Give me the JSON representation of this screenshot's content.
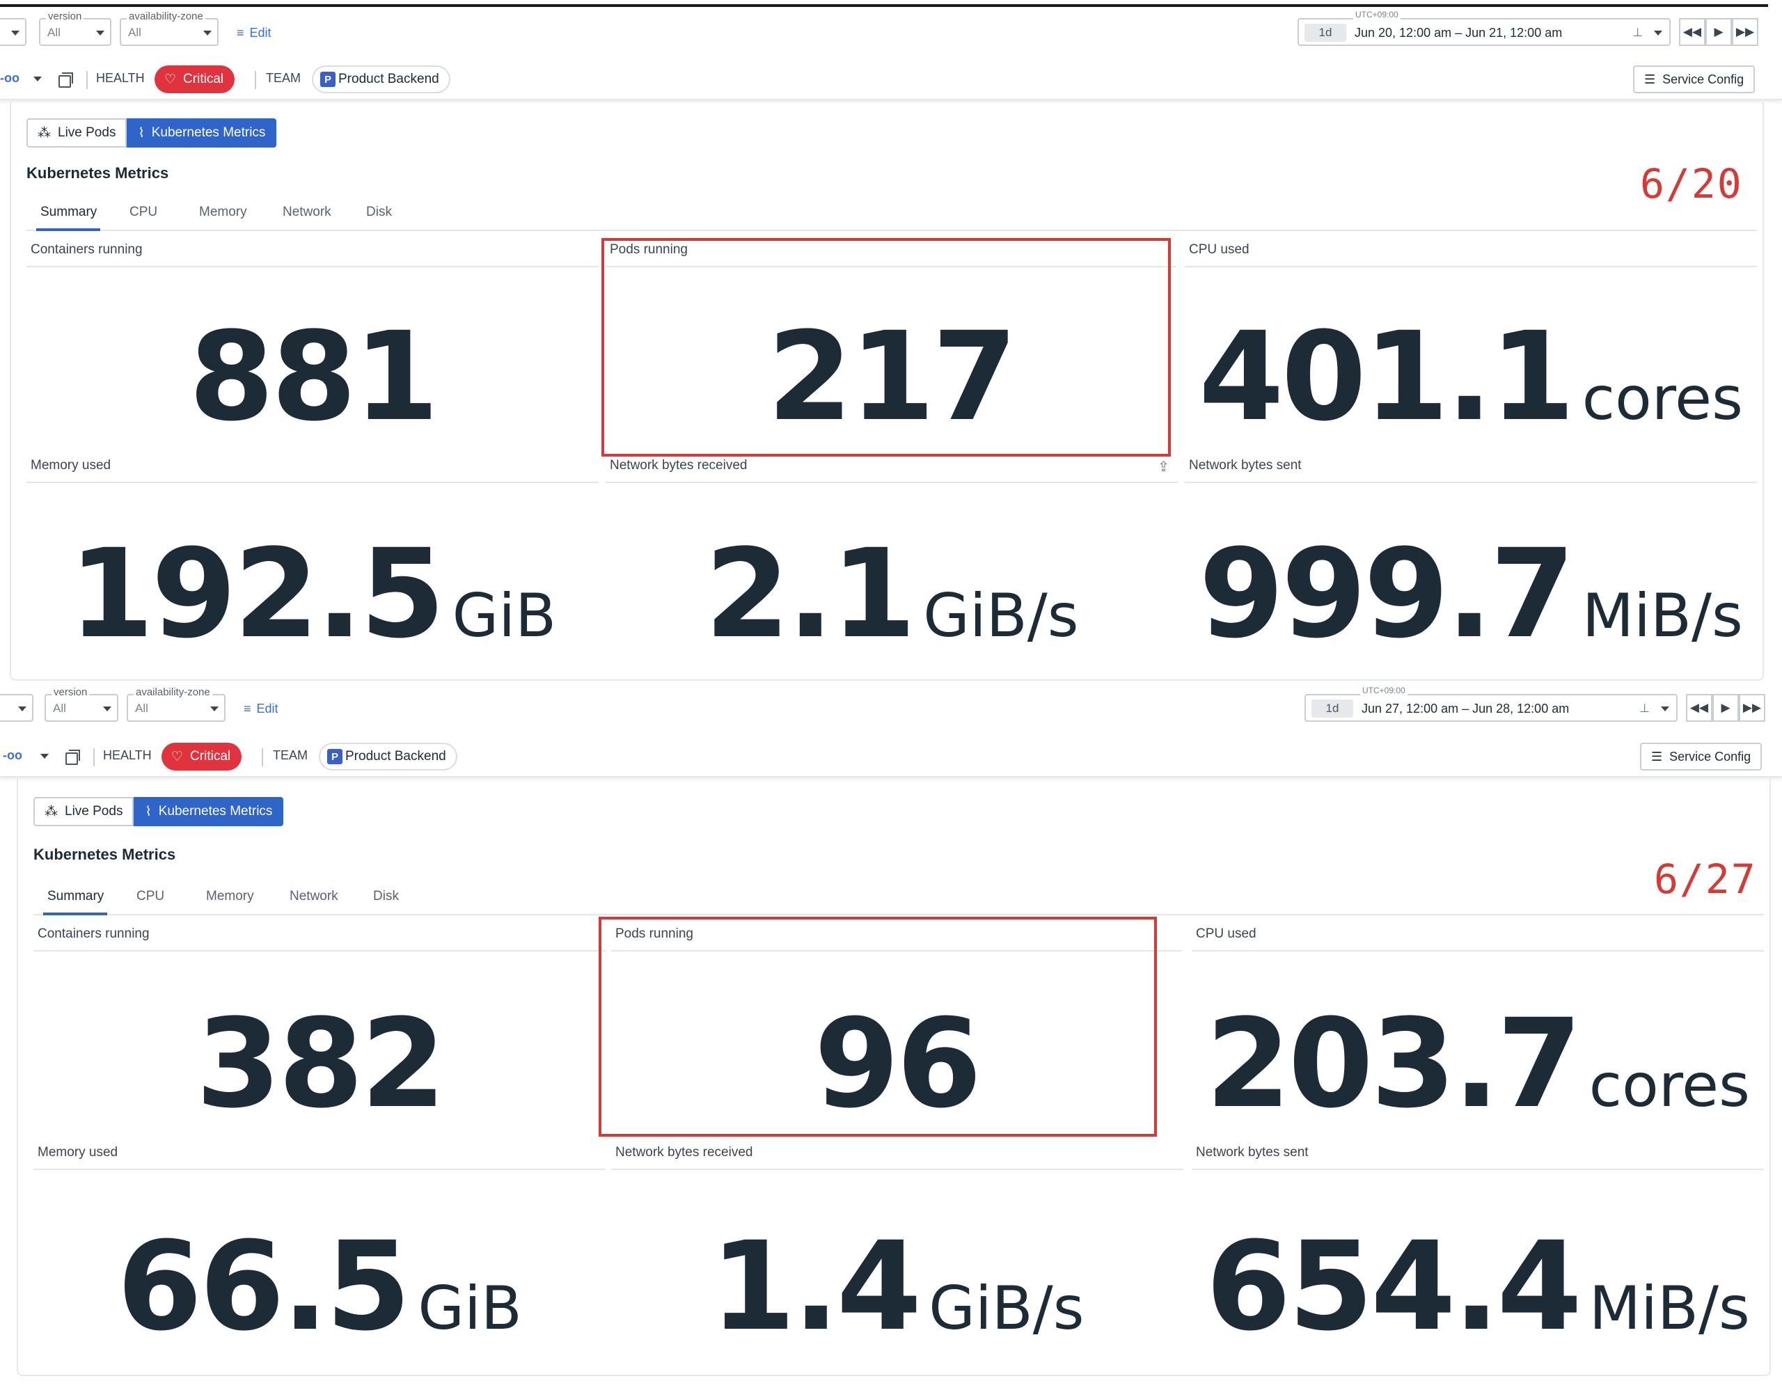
{
  "panels": [
    {
      "filters": {
        "version": {
          "label": "version",
          "value": "All"
        },
        "availability_zone": {
          "label": "availability-zone",
          "value": "All"
        },
        "edit_label": "Edit"
      },
      "time": {
        "timezone": "UTC+09:00",
        "range_tag": "1d",
        "range_text": "Jun 20, 12:00 am – Jun 21, 12:00 am"
      },
      "health": {
        "health_label": "HEALTH",
        "status_label": "Critical",
        "team_label": "TEAM",
        "team_badge": "P",
        "team_name": "Product Backend",
        "service_config_label": "Service Config"
      },
      "view_toggle": {
        "live_pods_label": "Live Pods",
        "k8s_metrics_label": "Kubernetes Metrics"
      },
      "section_title": "Kubernetes Metrics",
      "date_annotation": "6/20",
      "tabs": [
        "Summary",
        "CPU",
        "Memory",
        "Network",
        "Disk"
      ],
      "active_tab": "Summary",
      "metrics": {
        "containers_running": {
          "title": "Containers running",
          "value": "881",
          "unit": ""
        },
        "pods_running": {
          "title": "Pods running",
          "value": "217",
          "unit": ""
        },
        "cpu_used": {
          "title": "CPU used",
          "value": "401.1",
          "unit": "cores"
        },
        "memory_used": {
          "title": "Memory used",
          "value": "192.5",
          "unit": "GiB"
        },
        "net_received": {
          "title": "Network bytes received",
          "value": "2.1",
          "unit": "GiB/s"
        },
        "net_sent": {
          "title": "Network bytes sent",
          "value": "999.7",
          "unit": "MiB/s"
        }
      }
    },
    {
      "filters": {
        "version": {
          "label": "version",
          "value": "All"
        },
        "availability_zone": {
          "label": "availability-zone",
          "value": "All"
        },
        "edit_label": "Edit"
      },
      "time": {
        "timezone": "UTC+09:00",
        "range_tag": "1d",
        "range_text": "Jun 27, 12:00 am – Jun 28, 12:00 am"
      },
      "health": {
        "health_label": "HEALTH",
        "status_label": "Critical",
        "team_label": "TEAM",
        "team_badge": "P",
        "team_name": "Product Backend",
        "service_config_label": "Service Config"
      },
      "view_toggle": {
        "live_pods_label": "Live Pods",
        "k8s_metrics_label": "Kubernetes Metrics"
      },
      "section_title": "Kubernetes Metrics",
      "date_annotation": "6/27",
      "tabs": [
        "Summary",
        "CPU",
        "Memory",
        "Network",
        "Disk"
      ],
      "active_tab": "Summary",
      "metrics": {
        "containers_running": {
          "title": "Containers running",
          "value": "382",
          "unit": ""
        },
        "pods_running": {
          "title": "Pods running",
          "value": "96",
          "unit": ""
        },
        "cpu_used": {
          "title": "CPU used",
          "value": "203.7",
          "unit": "cores"
        },
        "memory_used": {
          "title": "Memory used",
          "value": "66.5",
          "unit": "GiB"
        },
        "net_received": {
          "title": "Network bytes received",
          "value": "1.4",
          "unit": "GiB/s"
        },
        "net_sent": {
          "title": "Network bytes sent",
          "value": "654.4",
          "unit": "MiB/s"
        }
      }
    }
  ],
  "colors": {
    "critical": "#e0333d",
    "accent": "#2f64c8",
    "highlight": "#d63a34"
  }
}
